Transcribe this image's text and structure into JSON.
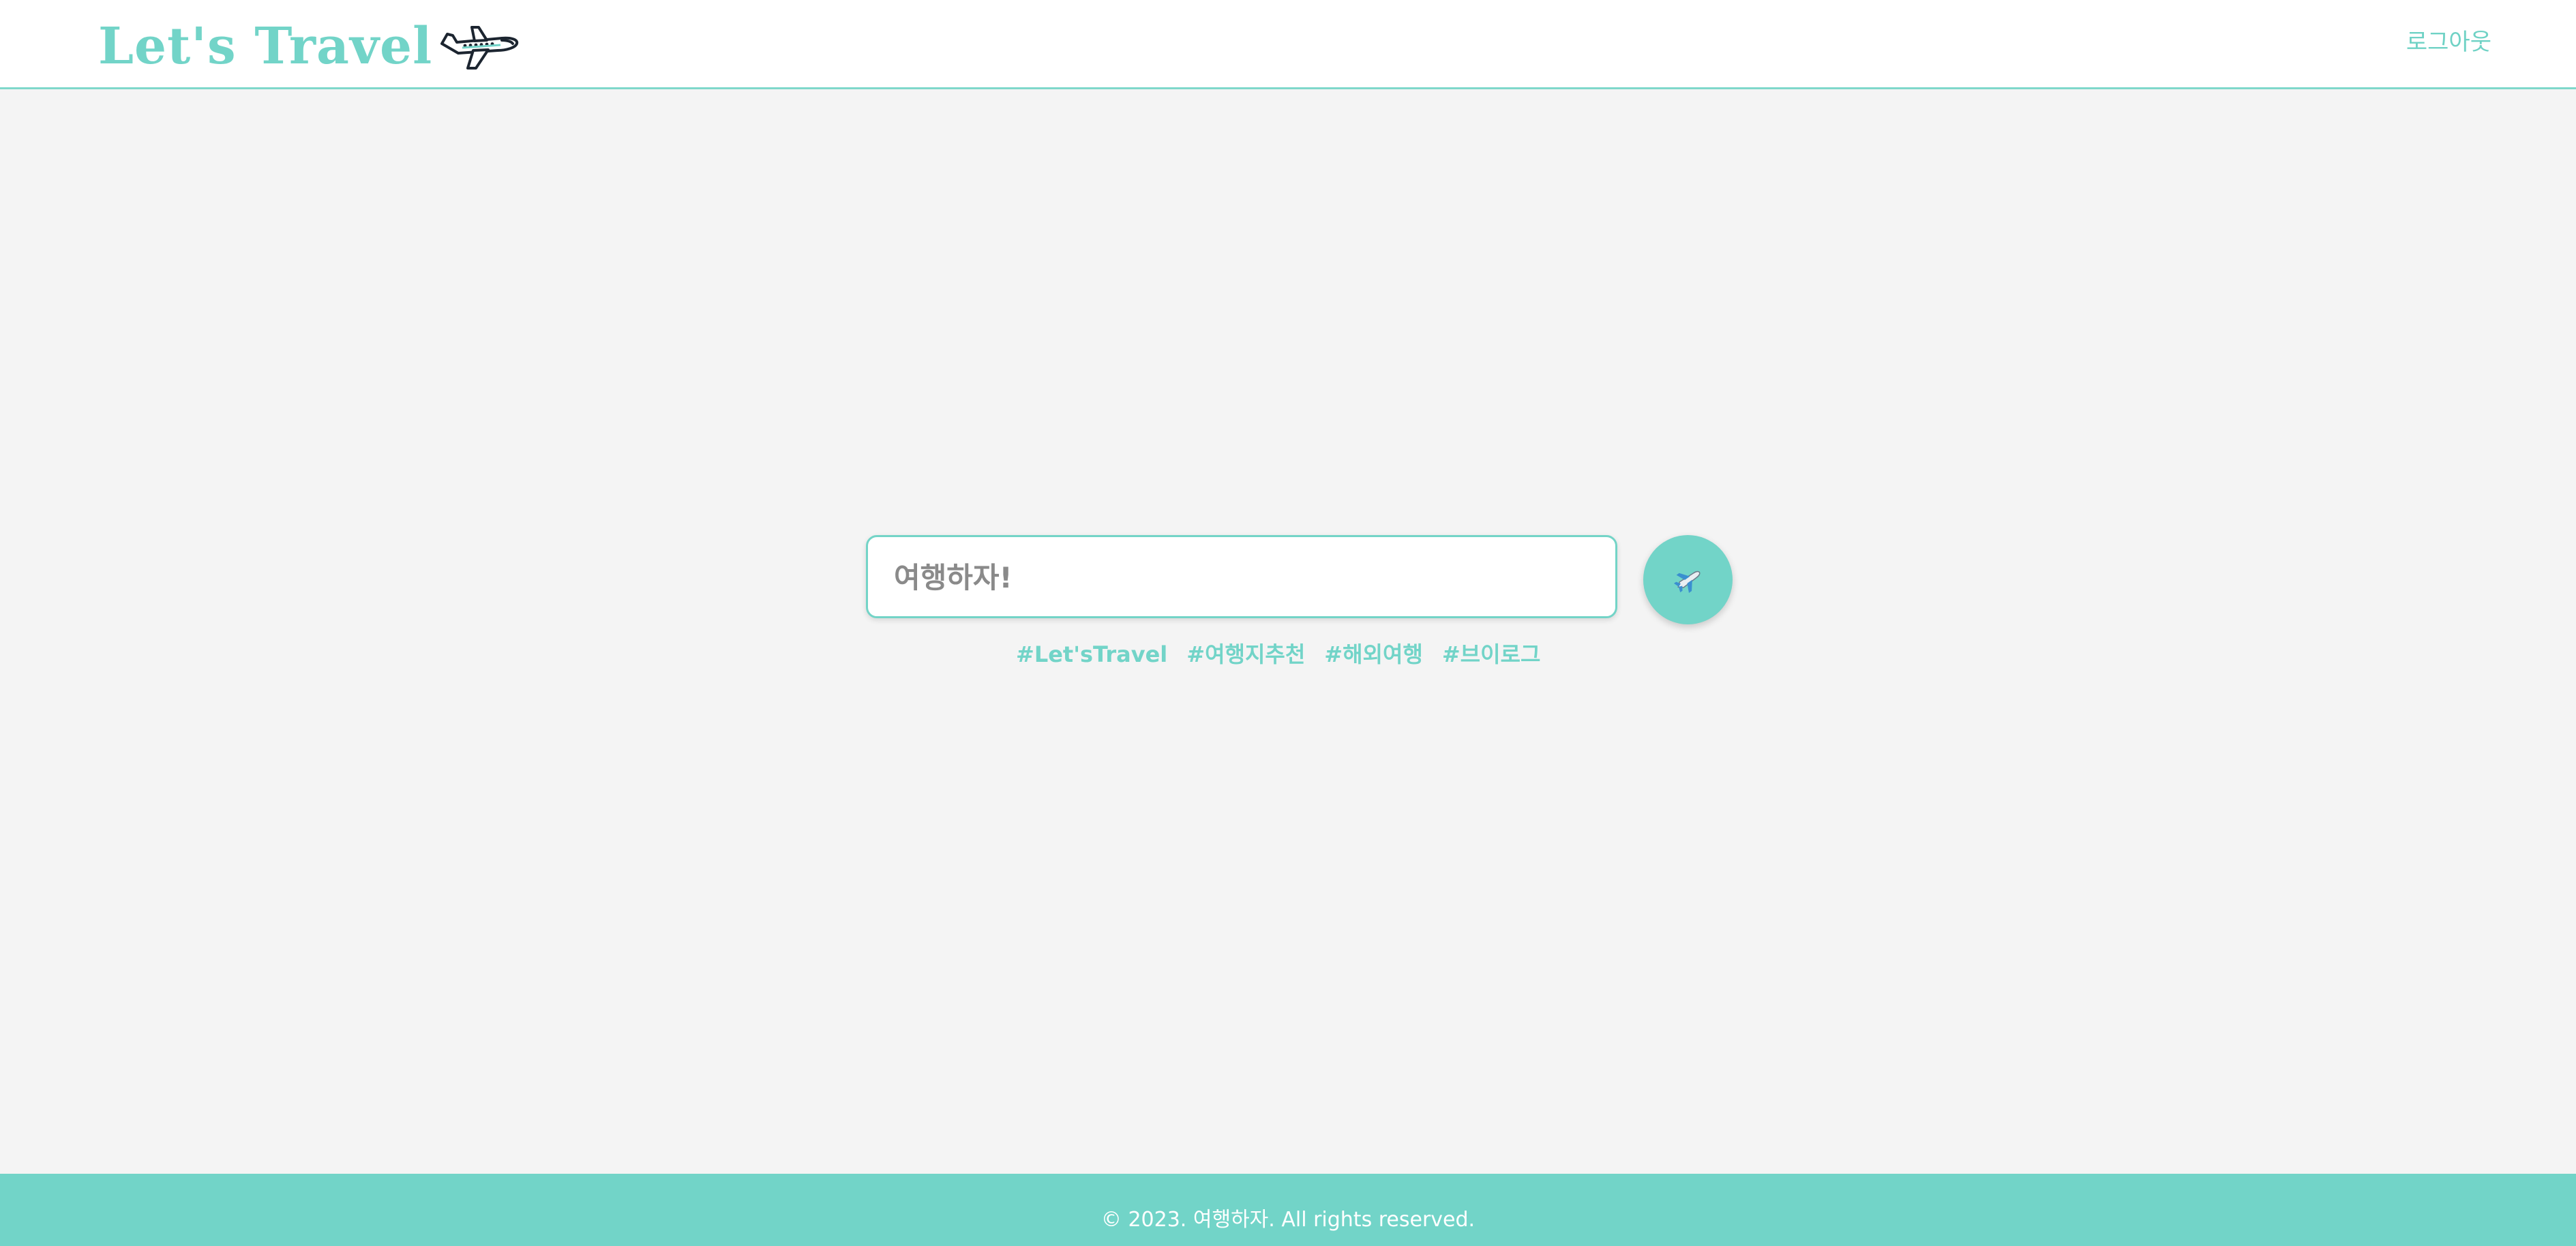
{
  "header": {
    "logo_text": "Let's Travel",
    "logo_icon": "airplane-icon",
    "logout_label": "로그아웃"
  },
  "search": {
    "placeholder": "여행하자!",
    "button_icon": "airplane-icon"
  },
  "tags": [
    "#Let'sTravel",
    "#여행지추천",
    "#해외여행",
    "#브이로그"
  ],
  "footer": {
    "copyright": "© 2023. 여행하자. All rights reserved."
  },
  "colors": {
    "accent": "#72d4c8",
    "background": "#f4f4f4",
    "header_bg": "#ffffff"
  }
}
